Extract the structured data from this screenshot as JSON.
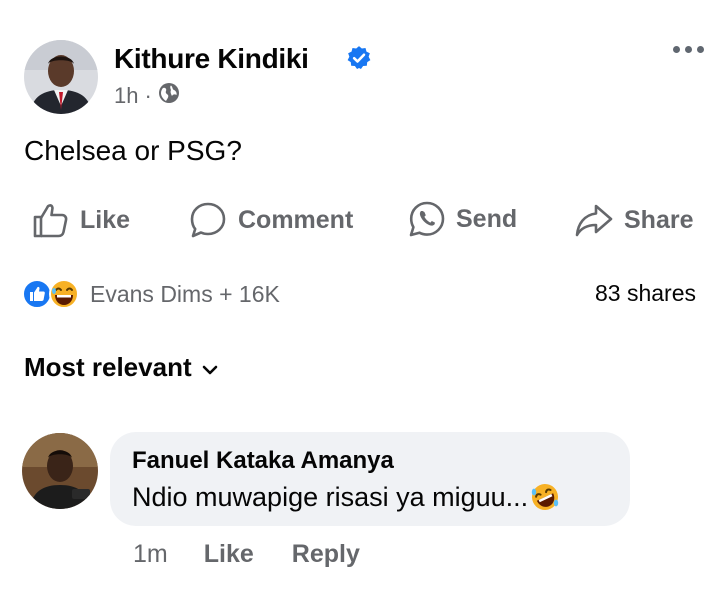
{
  "post": {
    "author": "Kithure Kindiki",
    "time": "1h",
    "separator": "·",
    "text": "Chelsea or PSG?"
  },
  "actions": {
    "like": "Like",
    "comment": "Comment",
    "send": "Send",
    "share": "Share"
  },
  "reactions": {
    "summary": "Evans Dims + 16K",
    "shares": "83 shares"
  },
  "sort": {
    "label": "Most relevant"
  },
  "comment": {
    "author": "Fanuel Kataka Amanya",
    "text": "Ndio muwapige risasi ya miguu...",
    "time": "1m",
    "like": "Like",
    "reply": "Reply"
  },
  "colors": {
    "verified": "#1877f2",
    "secondary_text": "#65676b",
    "bubble": "#f0f2f5"
  }
}
